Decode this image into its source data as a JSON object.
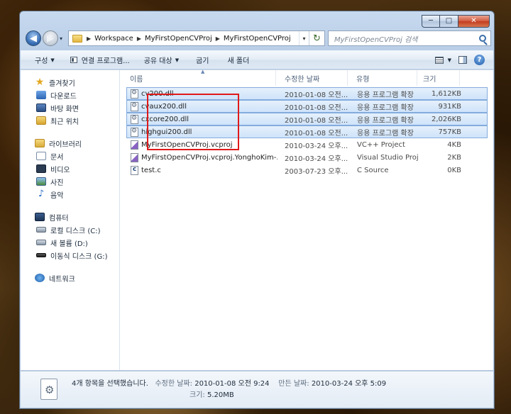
{
  "window": {
    "minimize": "─",
    "maximize": "□",
    "close": "✕"
  },
  "nav": {
    "back": "◀",
    "forward": "▶",
    "recent_dropdown": "▾"
  },
  "address": {
    "crumbs": [
      "Workspace",
      "MyFirstOpenCVProj",
      "MyFirstOpenCVProj"
    ],
    "separator": "▶",
    "dropdown": "▾",
    "refresh": "↻"
  },
  "search": {
    "placeholder": "MyFirstOpenCVProj 검색"
  },
  "toolbar": {
    "organize": "구성",
    "open_with": "연결 프로그램...",
    "share_with": "공유 대상",
    "burn": "굽기",
    "new_folder": "새 폴더",
    "help": "?"
  },
  "sidebar": {
    "favorites": {
      "label": "즐겨찾기",
      "items": [
        "다운로드",
        "바탕 화면",
        "최근 위치"
      ]
    },
    "libraries": {
      "label": "라이브러리",
      "items": [
        "문서",
        "비디오",
        "사진",
        "음악"
      ]
    },
    "computer": {
      "label": "컴퓨터",
      "items": [
        "로컬 디스크 (C:)",
        "새 볼륨 (D:)",
        "이동식 디스크 (G:)"
      ]
    },
    "network": {
      "label": "네트워크"
    }
  },
  "columns": {
    "name": "이름",
    "date": "수정한 날짜",
    "type": "유형",
    "size": "크기"
  },
  "files": [
    {
      "name": "cv200.dll",
      "date": "2010-01-08 오전...",
      "type": "응용 프로그램 확장",
      "size": "1,612KB",
      "selected": true,
      "icon": "dll-icon"
    },
    {
      "name": "cvaux200.dll",
      "date": "2010-01-08 오전...",
      "type": "응용 프로그램 확장",
      "size": "931KB",
      "selected": true,
      "icon": "dll-icon"
    },
    {
      "name": "cxcore200.dll",
      "date": "2010-01-08 오전...",
      "type": "응용 프로그램 확장",
      "size": "2,026KB",
      "selected": true,
      "icon": "dll-icon"
    },
    {
      "name": "highgui200.dll",
      "date": "2010-01-08 오전...",
      "type": "응용 프로그램 확장",
      "size": "757KB",
      "selected": true,
      "icon": "dll-icon"
    },
    {
      "name": "MyFirstOpenCVProj.vcproj",
      "date": "2010-03-24 오후...",
      "type": "VC++ Project",
      "size": "4KB",
      "selected": false,
      "icon": "vcproj-icon"
    },
    {
      "name": "MyFirstOpenCVProj.vcproj.YonghoKim-...",
      "date": "2010-03-24 오후...",
      "type": "Visual Studio Proj...",
      "size": "2KB",
      "selected": false,
      "icon": "vcproj-icon"
    },
    {
      "name": "test.c",
      "date": "2003-07-23 오후...",
      "type": "C Source",
      "size": "0KB",
      "selected": false,
      "icon": "c-file-icon"
    }
  ],
  "details": {
    "selection": "4개 항목을 선택했습니다.",
    "modified_label": "수정한 날짜:",
    "modified_value": "2010-01-08 오전 9:24",
    "created_label": "만든 날짜:",
    "created_value": "2010-03-24 오후 5:09",
    "size_label": "크기:",
    "size_value": "5.20MB"
  },
  "colors": {
    "highlight_box": "#e01a1a",
    "selection": "#cfe3fa"
  }
}
